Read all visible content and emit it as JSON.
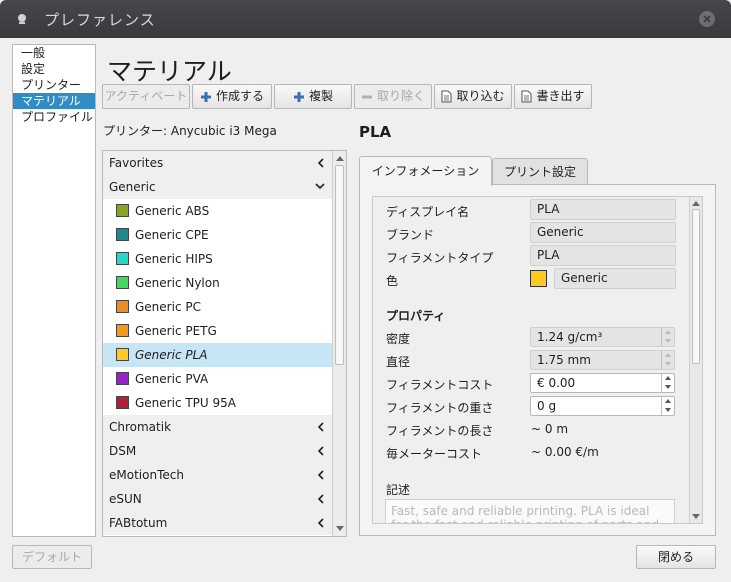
{
  "window": {
    "title": "プレファレンス"
  },
  "nav": {
    "items": [
      "一般",
      "設定",
      "プリンター",
      "マテリアル",
      "プロファイル"
    ],
    "selected_index": 3
  },
  "page": {
    "title": "マテリアル"
  },
  "toolbar": {
    "activate": "アクティベート",
    "create": "作成する",
    "duplicate": "複製",
    "remove": "取り除く",
    "import": "取り込む",
    "export": "書き出す"
  },
  "printer": {
    "label": "プリンター: Anycubic i3 Mega"
  },
  "materials": {
    "brands": {
      "favorites": "Favorites",
      "generic": "Generic",
      "chromatik": "Chromatik",
      "dsm": "DSM",
      "emotiontech": "eMotionTech",
      "esun": "eSUN",
      "fabtotum": "FABtotum"
    },
    "generic_items": [
      {
        "name": "Generic ABS",
        "color": "#8aa61e"
      },
      {
        "name": "Generic CPE",
        "color": "#1a8c8c"
      },
      {
        "name": "Generic HIPS",
        "color": "#21d9c6"
      },
      {
        "name": "Generic Nylon",
        "color": "#3fd95b"
      },
      {
        "name": "Generic PC",
        "color": "#f28a24"
      },
      {
        "name": "Generic PETG",
        "color": "#f29b1a"
      },
      {
        "name": "Generic PLA",
        "color": "#ffc924"
      },
      {
        "name": "Generic PVA",
        "color": "#9b1fd1"
      },
      {
        "name": "Generic TPU 95A",
        "color": "#b31f3a"
      }
    ],
    "selected_name": "Generic PLA"
  },
  "detail": {
    "name": "PLA",
    "tabs": {
      "info": "インフォメーション",
      "print": "プリント設定"
    },
    "display_name_label": "ディスプレイ名",
    "display_name": "PLA",
    "brand_label": "ブランド",
    "brand": "Generic",
    "filament_type_label": "フィラメントタイプ",
    "filament_type": "PLA",
    "color_label": "色",
    "color_name": "Generic",
    "color_hex": "#ffc924",
    "properties_header": "プロパティ",
    "density_label": "密度",
    "density": "1.24 g/cm³",
    "diameter_label": "直径",
    "diameter": "1.75 mm",
    "cost_label": "フィラメントコスト",
    "cost": "€ 0.00",
    "weight_label": "フィラメントの重さ",
    "weight": "0 g",
    "length_label": "フィラメントの長さ",
    "length": "~ 0 m",
    "cost_per_meter_label": "毎メーターコスト",
    "cost_per_meter": "~ 0.00 €/m",
    "description_label": "記述",
    "description": "Fast, safe and reliable printing. PLA is ideal for the fast and reliable printing of parts and"
  },
  "footer": {
    "defaults": "デフォルト",
    "close": "閉める"
  }
}
